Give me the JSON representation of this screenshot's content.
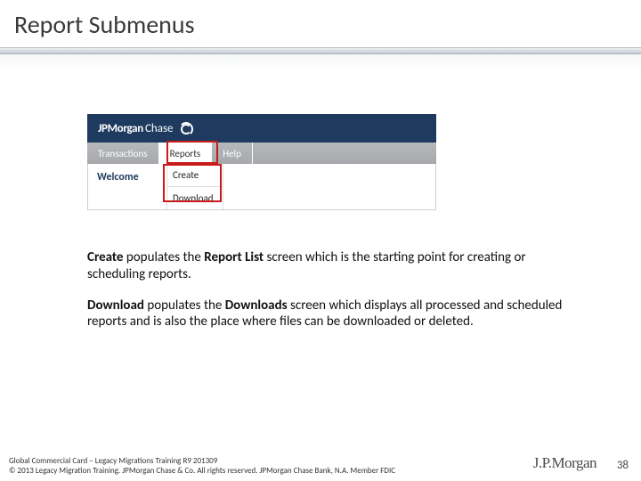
{
  "title": "Report Submenus",
  "screenshot": {
    "brand_bold": "JPMorgan",
    "brand_plain": "Chase",
    "tabs": {
      "transactions": "Transactions",
      "reports": "Reports",
      "help": "Help"
    },
    "welcome": "Welcome",
    "menu": {
      "create": "Create",
      "download": "Download"
    }
  },
  "para1": {
    "b1": "Create ",
    "t1": "populates the ",
    "b2": "Report List ",
    "t2": "screen which is the starting point for creating or scheduling reports."
  },
  "para2": {
    "b1": "Download ",
    "t1": "populates the ",
    "b2": "Downloads ",
    "t2": "screen which displays all processed and scheduled reports and is also the place where files can be downloaded or deleted."
  },
  "footer": {
    "line1": "Global Commercial Card – Legacy Migrations Training R9 201309",
    "line2": "© 2013 Legacy Migration Training. JPMorgan Chase & Co. All rights reserved. JPMorgan Chase Bank, N.A. Member FDIC"
  },
  "footer_logo": "J.P.Morgan",
  "page_number": "38"
}
